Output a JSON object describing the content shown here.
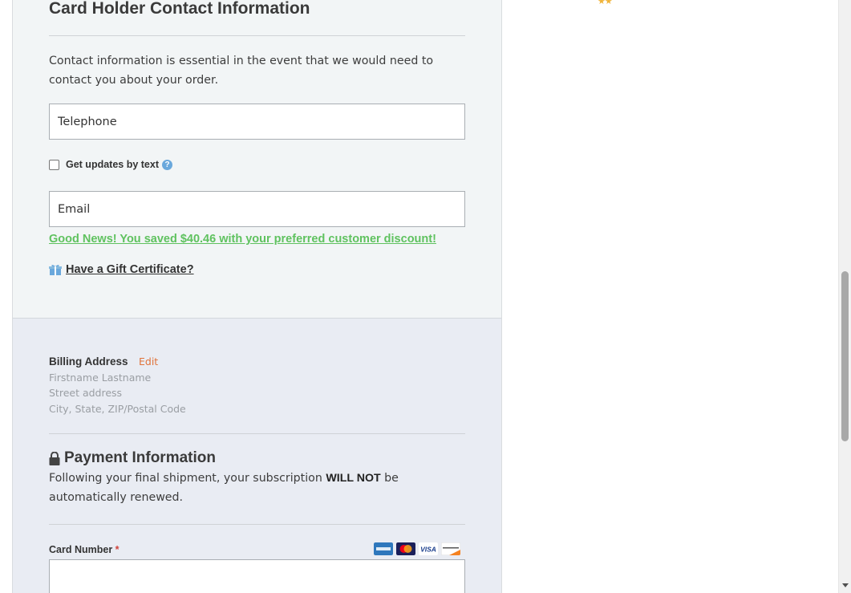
{
  "contact": {
    "title": "Card Holder Contact Information",
    "intro": "Contact information is essential in the event that we would need to contact you about your order.",
    "telephone_placeholder": "Telephone",
    "sms_label": "Get updates by text",
    "help_glyph": "?",
    "email_placeholder": "Email",
    "discount_message": "Good News! You saved $40.46 with your preferred customer discount!",
    "gift_link": "Have a Gift Certificate?"
  },
  "billing": {
    "label": "Billing Address",
    "edit_label": "Edit",
    "name_line": "Firstname Lastname",
    "street_line": "Street address",
    "city_line": "City, State, ZIP/Postal Code"
  },
  "payment": {
    "title": "Payment Information",
    "note_before": "Following your final shipment, your subscription ",
    "note_bold": "WILL NOT",
    "note_after": " be automatically renewed.",
    "card_number_label": "Card Number",
    "required_mark": "*",
    "card_logos": [
      "amex-logo",
      "mastercard-logo",
      "visa-logo",
      "discover-logo"
    ],
    "visa_text": "VISA"
  },
  "rating": {
    "stars": "★★"
  },
  "icons": {
    "gift": "gift-icon",
    "lock": "lock-icon",
    "help": "help-icon"
  },
  "colors": {
    "discount_green": "#5fc25f",
    "edit_orange": "#e0733a",
    "help_blue": "#6aa8dc",
    "required_red": "#d0443c",
    "star_gold": "#f0b43a"
  }
}
